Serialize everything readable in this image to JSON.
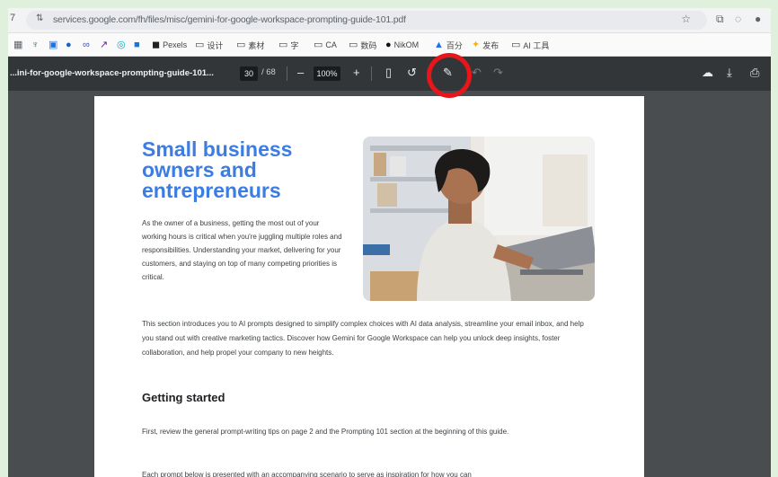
{
  "browser": {
    "edge_char": "7",
    "url": "services.google.com/fh/files/misc/gemini-for-google-workspace-prompting-guide-101.pdf",
    "bookmarks": [
      {
        "label": "Pexels",
        "icon": "pexels-icon"
      },
      {
        "label": "设计",
        "icon": "folder-icon"
      },
      {
        "label": "素材",
        "icon": "folder-icon"
      },
      {
        "label": "字",
        "icon": "folder-icon"
      },
      {
        "label": "CA",
        "icon": "folder-icon"
      },
      {
        "label": "数码",
        "icon": "folder-icon"
      },
      {
        "label": "NikOM",
        "icon": "globe-icon"
      },
      {
        "label": "百分",
        "icon": "app-icon"
      },
      {
        "label": "发布",
        "icon": "app-icon"
      },
      {
        "label": "AI 工具",
        "icon": "folder-icon"
      }
    ]
  },
  "pdf_toolbar": {
    "title": "...ini-for-google-workspace-prompting-guide-101...",
    "page_current": "30",
    "page_total": "/ 68",
    "zoom": "100%",
    "zoom_out": "–",
    "zoom_in": "+"
  },
  "document": {
    "title": "Small business owners and entrepreneurs",
    "intro": "As the owner of a business, getting the most out of your working hours is critical when you're juggling multiple roles and responsibilities. Understanding your market, delivering for your customers, and staying on top of many competing priorities is critical.",
    "section_intro": "This section introduces you to AI prompts designed to simplify complex choices with AI data analysis, streamline your email inbox, and help you stand out with creative marketing tactics. Discover how Gemini for Google Workspace can help you unlock deep insights, foster collaboration, and help propel your company to new heights.",
    "getting_started_heading": "Getting started",
    "getting_started_text": "First, review the general prompt-writing tips on page 2 and the Prompting 101 section at the beginning of this guide.",
    "next_text": "Each prompt below is presented with an accompanying scenario to serve as inspiration for how you can"
  },
  "colors": {
    "title_blue": "#3b7de3",
    "highlight_red": "#e8161b",
    "toolbar_bg": "#323639",
    "viewer_bg": "#4a4d50"
  }
}
